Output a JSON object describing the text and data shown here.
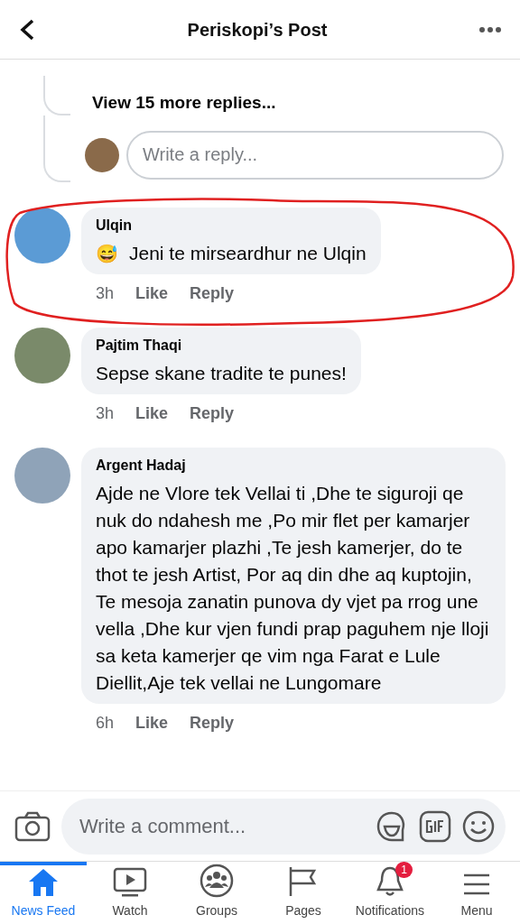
{
  "header": {
    "title": "Periskopi’s Post"
  },
  "thread": {
    "more_replies": "View 15 more replies...",
    "reply_placeholder": "Write a reply..."
  },
  "comments": [
    {
      "name": "Ulqin",
      "text": "Jeni te mirseardhur ne Ulqin",
      "emoji": "😅",
      "time": "3h",
      "like": "Like",
      "reply": "Reply",
      "highlighted": true
    },
    {
      "name": "Pajtim Thaqi",
      "text": "Sepse skane tradite te punes!",
      "time": "3h",
      "like": "Like",
      "reply": "Reply",
      "highlighted": false
    },
    {
      "name": "Argent Hadaj",
      "text": "Ajde ne Vlore tek Vellai ti ,Dhe te siguroji qe nuk do ndahesh me ,Po mir flet per kamarjer  apo kamarjer plazhi ,Te jesh kamerjer, do te thot te jesh Artist, Por aq din dhe aq kuptojin, Te mesoja zanatin punova dy vjet pa rrog une vella ,Dhe kur vjen fundi prap paguhem nje lloji sa keta kamerjer qe vim nga Farat e Lule Diellit,Aje tek vellai ne Lungomare",
      "time": "6h",
      "like": "Like",
      "reply": "Reply",
      "highlighted": false
    }
  ],
  "composer": {
    "placeholder": "Write a comment..."
  },
  "tabs": [
    {
      "kind": "home",
      "label": "News Feed",
      "selected": true
    },
    {
      "kind": "watch",
      "label": "Watch",
      "selected": false
    },
    {
      "kind": "groups",
      "label": "Groups",
      "selected": false
    },
    {
      "kind": "pages",
      "label": "Pages",
      "selected": false
    },
    {
      "kind": "bell",
      "label": "Notifications",
      "selected": false,
      "badge": "1"
    },
    {
      "kind": "menu",
      "label": "Menu",
      "selected": false
    }
  ]
}
